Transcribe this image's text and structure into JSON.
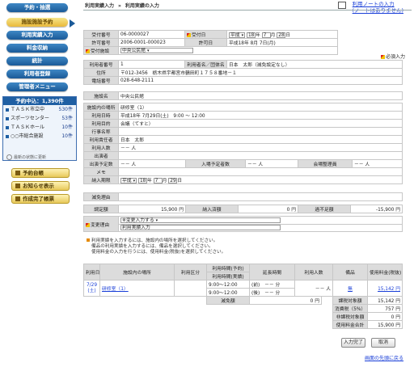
{
  "sidebar": {
    "nav": [
      "予約・抽選",
      "施設施設予約",
      "利用実績入力",
      "料金収納",
      "統計",
      "利用者登録",
      "管理者メニュー"
    ],
    "todo_title": "予約中込：1,390件",
    "todo_items": [
      {
        "label": "ＴＡＳＫ市立中",
        "count": "530件"
      },
      {
        "label": "スポーツセンター",
        "count": "53件"
      },
      {
        "label": "ＴＡＳＫホール",
        "count": "10件"
      },
      {
        "label": "○○市総合施設",
        "count": "10件"
      }
    ],
    "update_note": "最新の状態に更新",
    "yellow_buttons": [
      "予約台帳",
      "お知らせ表示",
      "作成完了帳票"
    ]
  },
  "header": {
    "breadcrumb_1": "利用実績入力",
    "breadcrumb_sep": "»",
    "breadcrumb_2": "利用実績の入力",
    "note_link_1": "利用ノートの入力",
    "note_link_2": "(ノートはありません)"
  },
  "form": {
    "reserve_no_label": "受付番号",
    "reserve_no": "06-0000027",
    "accept_date_label": "受付日",
    "era": "平成",
    "accept_year": "18",
    "year_unit": "年",
    "accept_month": "7",
    "month_unit": "月",
    "accept_day": "28",
    "day_unit": "日",
    "permit_no_label": "許可番号",
    "permit_no": "2006-0001-000023",
    "permit_date_label": "許可日",
    "permit_date": "平成18年 8月 7日(月)",
    "facility_accept_label": "受付施設",
    "facility_accept": "中央公民館",
    "required_note": "必須入力",
    "user_no_label": "利用者番号",
    "user_no": "1",
    "user_name_label": "利用者名／団体名",
    "user_name": "日本　太郎（減免設定なし）",
    "address_label": "住所",
    "address": "〒012-3456　栃木県宇都宮市鶴田町１７５８番地－１",
    "phone_label": "電話番号",
    "phone": "028-648-2111",
    "facility_label": "施設名",
    "facility": "中央公民館",
    "room_label": "施設内の場所",
    "room": "研修室（1）",
    "use_date_label": "利用日時",
    "use_date": "平成18年 7月29日(土)　9:00 ～ 12:00",
    "purpose_label": "利用目的",
    "purpose": "会議（てすと）",
    "event_label": "行事名称",
    "event": "",
    "manager_label": "利用責任者",
    "manager": "日本　太郎",
    "people_label": "利用人数",
    "people": "－－ 人",
    "present_label": "出演者",
    "present": "",
    "planned_label": "出演予定数",
    "planned": "－－ 人",
    "entry_label": "入場予定者数",
    "entry": "－－ 人",
    "venue_label": "会場整理員",
    "venue": "－－ 人",
    "memo_label": "メモ",
    "memo": "",
    "pay_limit_label": "納入期限",
    "pay_era": "平成",
    "pay_year": "18",
    "pay_month": "7",
    "pay_day": "29",
    "reduce_reason_label": "減免理由",
    "reduce_reason": "",
    "adjusted_label": "調定額",
    "adjusted": "15,900 円",
    "paid_label": "納入済額",
    "paid": "0 円",
    "overpay_label": "過不足額",
    "overpay": "-15,900 円",
    "change_reason_label": "変更理由",
    "change_reason_select": "※変更入力する",
    "change_reason_text": "利用実績入力"
  },
  "notes": {
    "line1": "利用実績を入力するには、施設内の場所を選択してください。",
    "line2": "備品の利用実績を入力するには、備品を選択してください。",
    "line3": "使用料金の入力を行うには、使用料金(税抜)を選択してください。"
  },
  "detail": {
    "headers": [
      "利用日",
      "施設内の場所",
      "利用区分",
      "利用時間(予約)",
      "利用時間(実績)",
      "延長時間",
      "利用人数",
      "備品",
      "使用料金(税抜)"
    ],
    "row": {
      "date": "7/29\n(土)",
      "date_l1": "7/29",
      "date_l2": "(土)",
      "room": "研修室（1）",
      "division": "",
      "time_plan": "9:00～12:00",
      "time_actual": "9:00～12:00",
      "ext_before": "(前)　－－ 分",
      "ext_after": "(後)　－－ 分",
      "people": "－－ 人",
      "equip": "無",
      "fee": "15,142 円"
    },
    "reduction_label": "減免額",
    "reduction": "0 円",
    "taxable_label": "課税対象額",
    "taxable": "15,142 円",
    "tax_label": "消費税（5%）",
    "tax": "757 円",
    "nontax_label": "非課税対象額",
    "nontax": "0 円",
    "total_label": "使用料金合計",
    "total": "15,900 円"
  },
  "actions": {
    "complete": "入力完了",
    "cancel": "取消",
    "back_to_top": "画面の先頭に戻る"
  }
}
